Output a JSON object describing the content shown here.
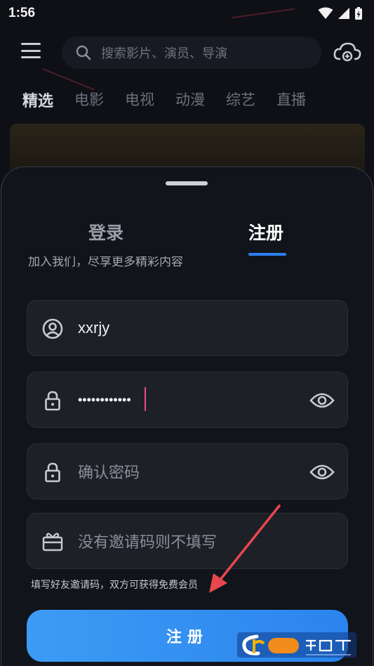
{
  "status_bar": {
    "time": "1:56"
  },
  "search": {
    "placeholder": "搜索影片、演员、导演"
  },
  "category_tabs": [
    "精选",
    "电影",
    "电视",
    "动漫",
    "综艺",
    "直播"
  ],
  "sheet": {
    "tabs": {
      "login": "登录",
      "register": "注册"
    },
    "subtitle": "加入我们，尽享更多精彩内容",
    "fields": {
      "username": {
        "value": "xxrjy"
      },
      "password": {
        "value": "••••••••••••"
      },
      "confirm_password": {
        "placeholder": "确认密码"
      },
      "invite_code": {
        "placeholder": "没有邀请码则不填写"
      }
    },
    "invite_hint": "填写好友邀请码，双方可获得免费会员",
    "submit_label": "注册"
  },
  "watermark": {
    "brand_text": "西西软件园",
    "url_text": "CR173.COM"
  },
  "colors": {
    "accent": "#2e7ff1",
    "caret": "#ec4d8a",
    "arrow": "#e8474f",
    "sheet_bg": "#12141b"
  }
}
